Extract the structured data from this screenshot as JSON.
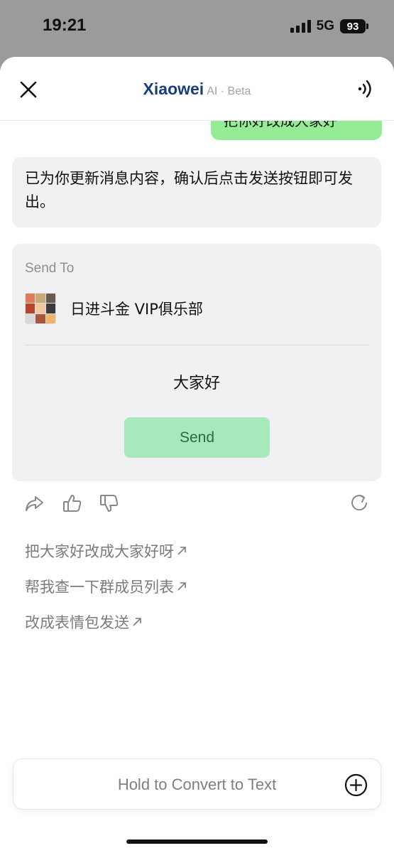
{
  "status_bar": {
    "time": "19:21",
    "network": "5G",
    "battery": "93"
  },
  "header": {
    "title": "Xiaowei",
    "subtitle": "AI · Beta"
  },
  "chat": {
    "user_message": "把你好改成大家好",
    "ai_message": "已为你更新消息内容，确认后点击发送按钮即可发出。"
  },
  "send_card": {
    "label": "Send To",
    "group_name": "日进斗金 VIP俱乐部",
    "message": "大家好",
    "send_label": "Send"
  },
  "suggestions": [
    {
      "text": "把大家好改成大家好呀"
    },
    {
      "text": "帮我查一下群成员列表"
    },
    {
      "text": "改成表情包发送"
    }
  ],
  "input_bar": {
    "placeholder": "Hold to Convert to Text"
  },
  "icons": {
    "close": "close-icon",
    "speaker": "speaker-icon",
    "share": "share-icon",
    "thumbs_up": "thumbs-up-icon",
    "thumbs_down": "thumbs-down-icon",
    "refresh": "refresh-icon",
    "plus": "plus-circle-icon",
    "arrow": "arrow-up-right-icon"
  },
  "colors": {
    "user_bubble": "#95ec95",
    "send_button": "#a7e8bc",
    "title": "#1a3d7c"
  }
}
